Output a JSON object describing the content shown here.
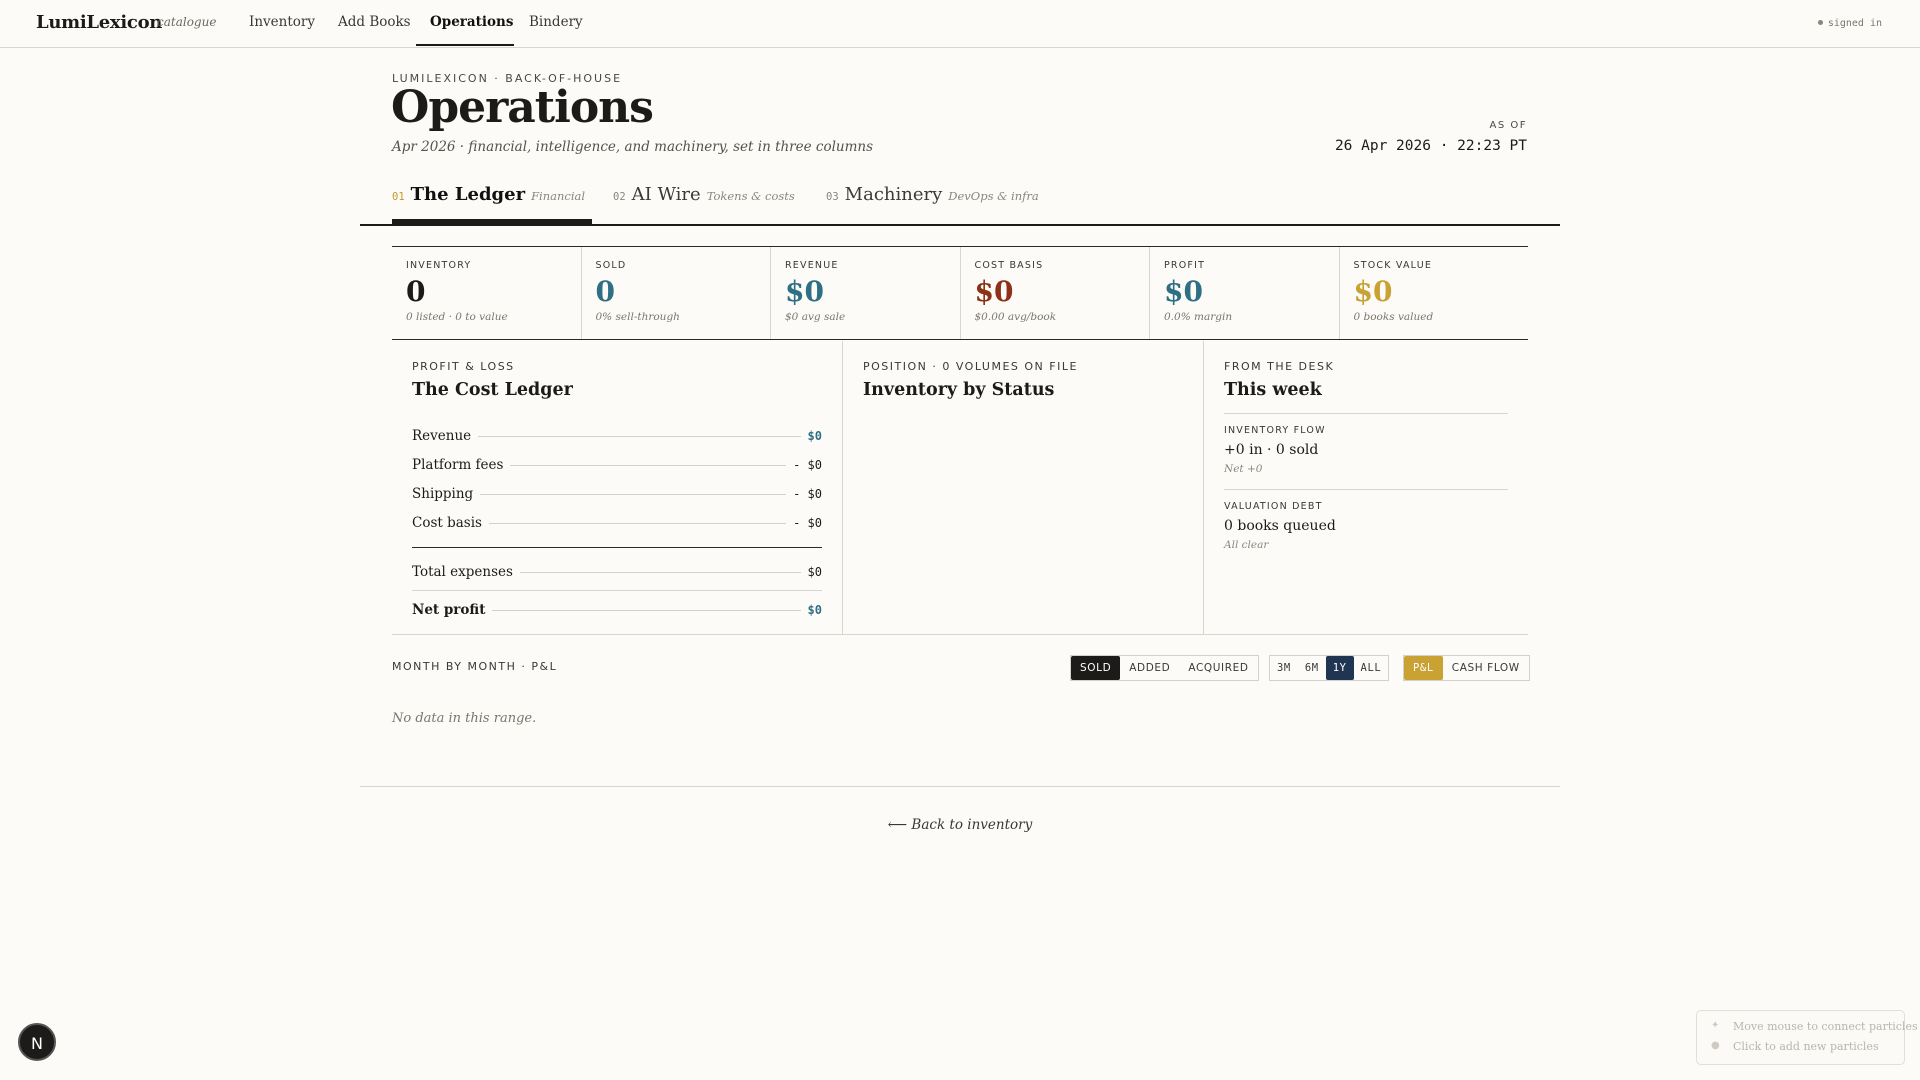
{
  "nav": {
    "brand": "LumiLexicon",
    "brand_sub": "catalogue",
    "links": [
      "Inventory",
      "Add Books",
      "Operations",
      "Bindery"
    ],
    "active": "Operations",
    "status": "signed in"
  },
  "header": {
    "eyebrow": "LUMILEXICON · BACK-OF-HOUSE",
    "title": "Operations",
    "subtitle": "Apr 2026 · financial, intelligence, and machinery, set in three columns",
    "asof_label": "AS OF",
    "asof_value": "26 Apr 2026 · 22:23 PT"
  },
  "tabs": [
    {
      "num": "01",
      "name": "The Ledger",
      "desc": "Financial",
      "active": true
    },
    {
      "num": "02",
      "name": "AI Wire",
      "desc": "Tokens & costs",
      "active": false
    },
    {
      "num": "03",
      "name": "Machinery",
      "desc": "DevOps & infra",
      "active": false
    }
  ],
  "stats": [
    {
      "label": "INVENTORY",
      "value": "0",
      "note": "0 listed · 0 to value",
      "color": "#1c1b19"
    },
    {
      "label": "SOLD",
      "value": "0",
      "note": "0% sell-through",
      "color": "#2f6f84"
    },
    {
      "label": "REVENUE",
      "value": "$0",
      "note": "$0 avg sale",
      "color": "#2f6f84"
    },
    {
      "label": "COST BASIS",
      "value": "$0",
      "note": "$0.00 avg/book",
      "color": "#8c3218"
    },
    {
      "label": "PROFIT",
      "value": "$0",
      "note": "0.0% margin",
      "color": "#2f6f84"
    },
    {
      "label": "STOCK VALUE",
      "value": "$0",
      "note": "0 books valued",
      "color": "#c9a233"
    }
  ],
  "pnl": {
    "eyebrow": "PROFIT & LOSS",
    "title": "The Cost Ledger",
    "rows": [
      {
        "label": "Revenue",
        "amount": "$0"
      },
      {
        "label": "Platform fees",
        "amount": "- $0"
      },
      {
        "label": "Shipping",
        "amount": "- $0"
      },
      {
        "label": "Cost basis",
        "amount": "- $0"
      }
    ],
    "total": {
      "label": "Total expenses",
      "amount": "$0"
    },
    "net": {
      "label": "Net profit",
      "amount": "$0"
    }
  },
  "position": {
    "eyebrow": "POSITION · 0 VOLUMES ON FILE",
    "title": "Inventory by Status"
  },
  "desk": {
    "eyebrow": "FROM THE DESK",
    "title": "This week",
    "blocks": [
      {
        "label": "INVENTORY FLOW",
        "value": "+0 in · 0 sold",
        "note": "Net +0"
      },
      {
        "label": "VALUATION DEBT",
        "value": "0 books queued",
        "note": "All clear"
      }
    ]
  },
  "monthly": {
    "label": "MONTH BY MONTH · P&L",
    "metric_options": [
      "SOLD",
      "ADDED",
      "ACQUIRED"
    ],
    "metric_selected": "SOLD",
    "range_options": [
      "3M",
      "6M",
      "1Y",
      "ALL"
    ],
    "range_selected": "1Y",
    "view_options": [
      "P&L",
      "CASH FLOW"
    ],
    "view_selected": "P&L",
    "empty": "No data in this range."
  },
  "footer": {
    "back": "⟵ Back to inventory"
  },
  "badge": "N",
  "hint": {
    "line1": "Move mouse to connect particles",
    "line2": "Click to add new particles"
  }
}
